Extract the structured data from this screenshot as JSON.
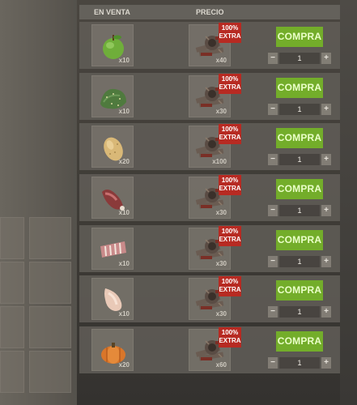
{
  "header": {
    "sale_label": "EN VENTA",
    "price_label": "PRECIO"
  },
  "badge": {
    "percent": "100%",
    "word": "EXTRA"
  },
  "buy_label": "COMPRA",
  "colors": {
    "buy_button": "#73ad2a",
    "badge": "#b72a22"
  },
  "offers": [
    {
      "item_icon": "apple-icon",
      "item_qty": "x10",
      "price_icon": "scrap-icon",
      "price_qty": "x40",
      "amount": "1"
    },
    {
      "item_icon": "cactus-flesh-icon",
      "item_qty": "x10",
      "price_icon": "scrap-icon",
      "price_qty": "x30",
      "amount": "1"
    },
    {
      "item_icon": "potato-icon",
      "item_qty": "x20",
      "price_icon": "scrap-icon",
      "price_qty": "x100",
      "amount": "1"
    },
    {
      "item_icon": "raw-meat-icon",
      "item_qty": "x10",
      "price_icon": "scrap-icon",
      "price_qty": "x30",
      "amount": "1"
    },
    {
      "item_icon": "raw-ribs-icon",
      "item_qty": "x10",
      "price_icon": "scrap-icon",
      "price_qty": "x30",
      "amount": "1"
    },
    {
      "item_icon": "raw-chicken-icon",
      "item_qty": "x10",
      "price_icon": "scrap-icon",
      "price_qty": "x30",
      "amount": "1"
    },
    {
      "item_icon": "pumpkin-icon",
      "item_qty": "x20",
      "price_icon": "scrap-icon",
      "price_qty": "x60",
      "amount": "1"
    }
  ]
}
